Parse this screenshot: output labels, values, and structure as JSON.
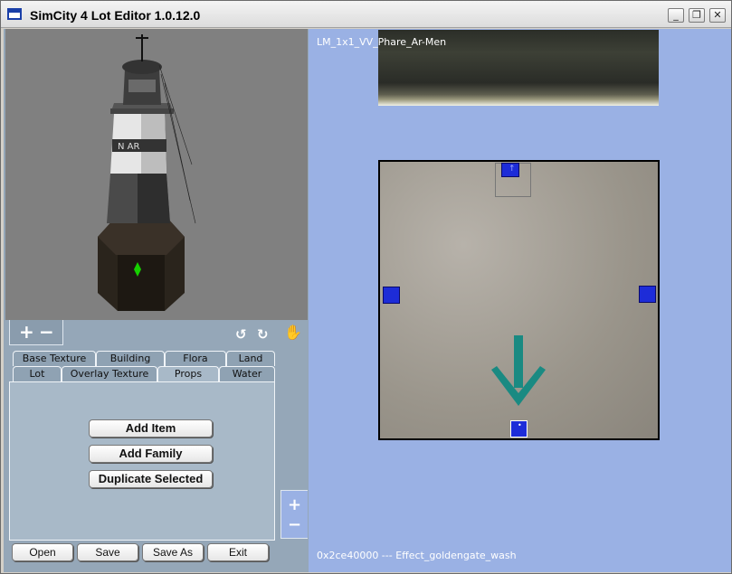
{
  "window": {
    "title": "SimCity 4 Lot Editor 1.0.12.0",
    "controls": {
      "minimize": "_",
      "maximize": "❐",
      "close": "✕"
    }
  },
  "preview": {
    "zoom_in": "+",
    "zoom_out": "−",
    "tool_icons": [
      "rotate-left-icon",
      "rotate-right-icon",
      "hand-icon"
    ]
  },
  "tabs": {
    "row_top": [
      "Base Texture",
      "Building",
      "Flora",
      "Land"
    ],
    "row_bottom": [
      "Lot",
      "Overlay Texture",
      "Props",
      "Water"
    ],
    "active": "Props"
  },
  "actions": {
    "add_item": "Add Item",
    "add_family": "Add Family",
    "duplicate_selected": "Duplicate Selected"
  },
  "footer_buttons": {
    "open": "Open",
    "save": "Save",
    "save_as": "Save As",
    "exit": "Exit"
  },
  "lot_view": {
    "lot_name": "LM_1x1_VV_Phare_Ar-Men",
    "status": "0x2ce40000 --- Effect_goldengate_wash",
    "zoom_in": "+",
    "zoom_out": "−",
    "arrow_color": "#1a8a82",
    "marker_color": "#1d2cd8",
    "background_color": "#9ab1e4"
  }
}
